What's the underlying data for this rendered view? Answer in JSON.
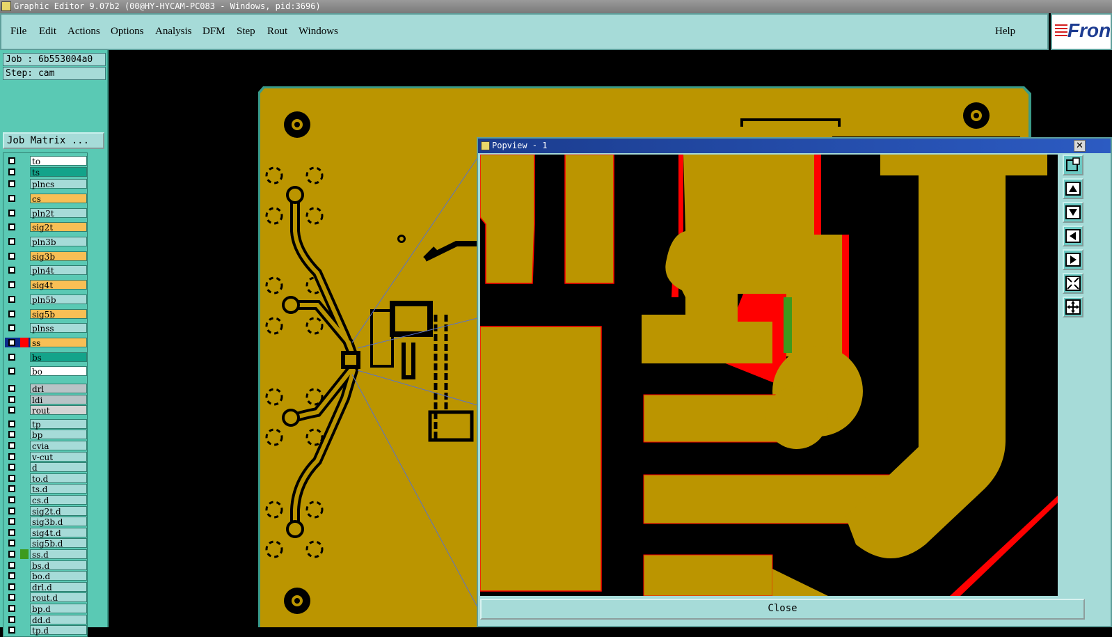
{
  "window": {
    "title": "Graphic Editor 9.07b2 (00@HY-HYCAM-PC083 - Windows, pid:3696)"
  },
  "menu": {
    "items": [
      "File",
      "Edit",
      "Actions",
      "Options",
      "Analysis",
      "DFM",
      "Step",
      "Rout",
      "Windows"
    ],
    "help": "Help"
  },
  "logo": {
    "text": "Fron"
  },
  "job": {
    "label": "Job : 6b553004a0",
    "step": "Step: cam",
    "matrix_button": "Job Matrix ..."
  },
  "layers": [
    {
      "name": "to",
      "color": "#ffffff"
    },
    {
      "name": "ts",
      "color": "#13a38a"
    },
    {
      "name": "plncs",
      "color": "#a6dbd8"
    },
    {
      "name": "cs",
      "color": "#f8bf55"
    },
    {
      "name": "pln2t",
      "color": "#a6dbd8"
    },
    {
      "name": "sig2t",
      "color": "#f8bf55"
    },
    {
      "name": "pln3b",
      "color": "#a6dbd8"
    },
    {
      "name": "sig3b",
      "color": "#f8bf55"
    },
    {
      "name": "pln4t",
      "color": "#a6dbd8"
    },
    {
      "name": "sig4t",
      "color": "#f8bf55"
    },
    {
      "name": "pln5b",
      "color": "#a6dbd8"
    },
    {
      "name": "sig5b",
      "color": "#f8bf55"
    },
    {
      "name": "plnss",
      "color": "#a6dbd8"
    },
    {
      "name": "ss",
      "color": "#f8bf55",
      "active": true
    },
    {
      "name": "bs",
      "color": "#13a38a"
    },
    {
      "name": "bo",
      "color": "#ffffff"
    },
    {
      "name": "drl",
      "color": "#b8c3c6"
    },
    {
      "name": "ldi",
      "color": "#b8c3c6"
    },
    {
      "name": "rout",
      "color": "#d4d4d4"
    },
    {
      "name": "tp",
      "color": "#a6dbd8"
    },
    {
      "name": "bp",
      "color": "#a6dbd8"
    },
    {
      "name": "cvia",
      "color": "#a6dbd8"
    },
    {
      "name": "v-cut",
      "color": "#a6dbd8"
    },
    {
      "name": "d",
      "color": "#a6dbd8"
    },
    {
      "name": "to.d",
      "color": "#a6dbd8"
    },
    {
      "name": "ts.d",
      "color": "#a6dbd8"
    },
    {
      "name": "cs.d",
      "color": "#a6dbd8"
    },
    {
      "name": "sig2t.d",
      "color": "#a6dbd8"
    },
    {
      "name": "sig3b.d",
      "color": "#a6dbd8"
    },
    {
      "name": "sig4t.d",
      "color": "#a6dbd8"
    },
    {
      "name": "sig5b.d",
      "color": "#a6dbd8"
    },
    {
      "name": "ss.d",
      "color": "#a6dbd8",
      "marker": "#3d9a1d"
    },
    {
      "name": "bs.d",
      "color": "#a6dbd8"
    },
    {
      "name": "bo.d",
      "color": "#a6dbd8"
    },
    {
      "name": "drl.d",
      "color": "#a6dbd8"
    },
    {
      "name": "rout.d",
      "color": "#a6dbd8"
    },
    {
      "name": "bp.d",
      "color": "#a6dbd8"
    },
    {
      "name": "dd.d",
      "color": "#a6dbd8"
    },
    {
      "name": "tp.d",
      "color": "#a6dbd8"
    }
  ],
  "popview": {
    "title": "Popview - 1",
    "close_label": "Close",
    "close_x": "✕"
  },
  "colors": {
    "copper": "#bb9500",
    "board_outline": "#3a9a88",
    "highlight": "#ff0000",
    "select": "#3d9a1d",
    "teal": "#a6dbd8"
  },
  "tools": [
    "zoom-window-icon",
    "pan-up-icon",
    "pan-down-icon",
    "pan-left-icon",
    "pan-right-icon",
    "fit-all-icon",
    "zoom-home-icon"
  ]
}
